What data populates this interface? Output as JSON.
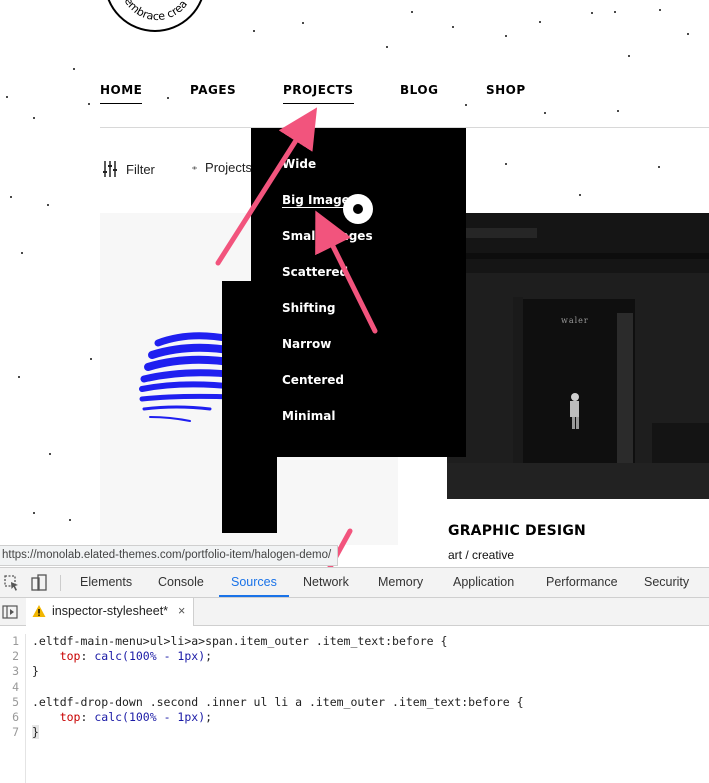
{
  "logo": {
    "text": "embrace crea"
  },
  "nav": {
    "items": [
      {
        "label": "HOME",
        "active": true
      },
      {
        "label": "PAGES",
        "active": false
      },
      {
        "label": "PROJECTS",
        "active": true
      },
      {
        "label": "BLOG",
        "active": false
      },
      {
        "label": "SHOP",
        "active": false
      }
    ]
  },
  "toolbar": {
    "filter_label": "Filter",
    "projects_label": "Projects"
  },
  "dropdown": {
    "items": [
      "Wide",
      "Big Images",
      "Small Images",
      "Scattered",
      "Shifting",
      "Narrow",
      "Centered",
      "Minimal"
    ],
    "current": "Big Images"
  },
  "portfolio": {
    "right_image_caption": "waler",
    "right_title": "GRAPHIC DESIGN",
    "right_subtitle": "art / creative"
  },
  "status_url": "https://monolab.elated-themes.com/portfolio-item/halogen-demo/",
  "devtools": {
    "tabs": [
      "Elements",
      "Console",
      "Sources",
      "Network",
      "Memory",
      "Application",
      "Performance",
      "Security"
    ],
    "active_tab": "Sources",
    "file_tab": "inspector-stylesheet*",
    "file_close": "×",
    "line_numbers": [
      "1",
      "2",
      "3",
      "4",
      "5",
      "6",
      "7"
    ],
    "code": {
      "l1": ".eltdf-main-menu>ul>li>a>span.item_outer .item_text:before {",
      "l2_prop": "top",
      "l2_val": "calc(100% - 1px)",
      "l3": "}",
      "l5": ".eltdf-drop-down .second .inner ul li a .item_outer .item_text:before {",
      "l6_prop": "top",
      "l6_val": "calc(100% - 1px)",
      "l7": "}"
    }
  },
  "colors": {
    "accent": "#1a73e8",
    "arrow": "#f2547d",
    "brush": "#1f1ff0"
  }
}
